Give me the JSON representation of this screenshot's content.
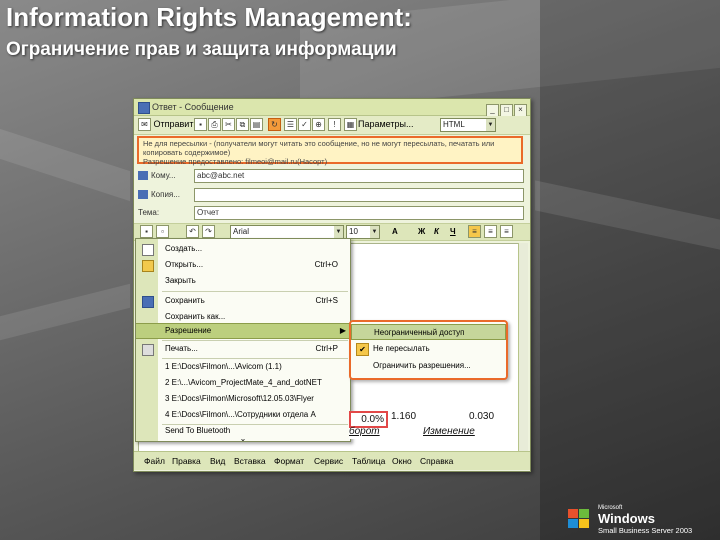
{
  "slide": {
    "title": "Information Rights Management:",
    "subtitle": "Ограничение прав и защита информации"
  },
  "window": {
    "title": "Ответ - Сообщение",
    "toolbar": {
      "send_label": "Отправить",
      "options_label": "Параметры...",
      "format_value": "HTML"
    },
    "infobar": {
      "line1": "Не для пересылки - (получатели могут читать это сообщение, но не могут пересылать, печатать или",
      "line2": "копировать содержимое)",
      "line3": "Разрешение предоставлено: filmeoi@mail.ru(Насорт)"
    },
    "fields": {
      "to_label": "Кому...",
      "to_value": "abc@abc.net",
      "cc_label": "Копия...",
      "cc_value": "",
      "subject_label": "Тема:",
      "subject_value": "Отчет"
    },
    "format_toolbar": {
      "font_value": "Arial",
      "size_value": "10"
    }
  },
  "file_menu": {
    "items": [
      {
        "label": "Создать...",
        "shortcut": ""
      },
      {
        "label": "Открыть...",
        "shortcut": "Ctrl+O"
      },
      {
        "label": "Закрыть",
        "shortcut": ""
      },
      {
        "label": "Сохранить",
        "shortcut": "Ctrl+S"
      },
      {
        "label": "Сохранить как...",
        "shortcut": ""
      },
      {
        "label": "Разрешение",
        "shortcut": ""
      },
      {
        "label": "Печать...",
        "shortcut": "Ctrl+P"
      },
      {
        "label": "1 E:\\Docs\\Filmon\\...\\Avicom (1.1)",
        "shortcut": ""
      },
      {
        "label": "2 E:\\...\\Avicom_ProjectMate_4_and_dotNET",
        "shortcut": ""
      },
      {
        "label": "3 E:\\Docs\\Filmon\\Microsoft\\12.05.03\\Flyer",
        "shortcut": ""
      },
      {
        "label": "4 E:\\Docs\\Filmon\\...\\Сотрудники отдела А",
        "shortcut": ""
      },
      {
        "label": "Send To Bluetooth",
        "shortcut": ""
      }
    ]
  },
  "permission_submenu": {
    "items": [
      {
        "label": "Неограниченный доступ"
      },
      {
        "label": "Не пересылать"
      },
      {
        "label": "Ограничить разрешения..."
      }
    ]
  },
  "sheet": {
    "cell1": "0.0%",
    "cell2": "1.160",
    "cell3": "0.030",
    "cell4": "борот",
    "cell5": "Изменение"
  },
  "menubar": {
    "items": [
      "Файл",
      "Правка",
      "Вид",
      "Вставка",
      "Формат",
      "Сервис",
      "Таблица",
      "Окно",
      "Справка"
    ]
  },
  "logo": {
    "brand": "Microsoft",
    "product": "Windows",
    "edition": "Small Business Server 2003"
  }
}
